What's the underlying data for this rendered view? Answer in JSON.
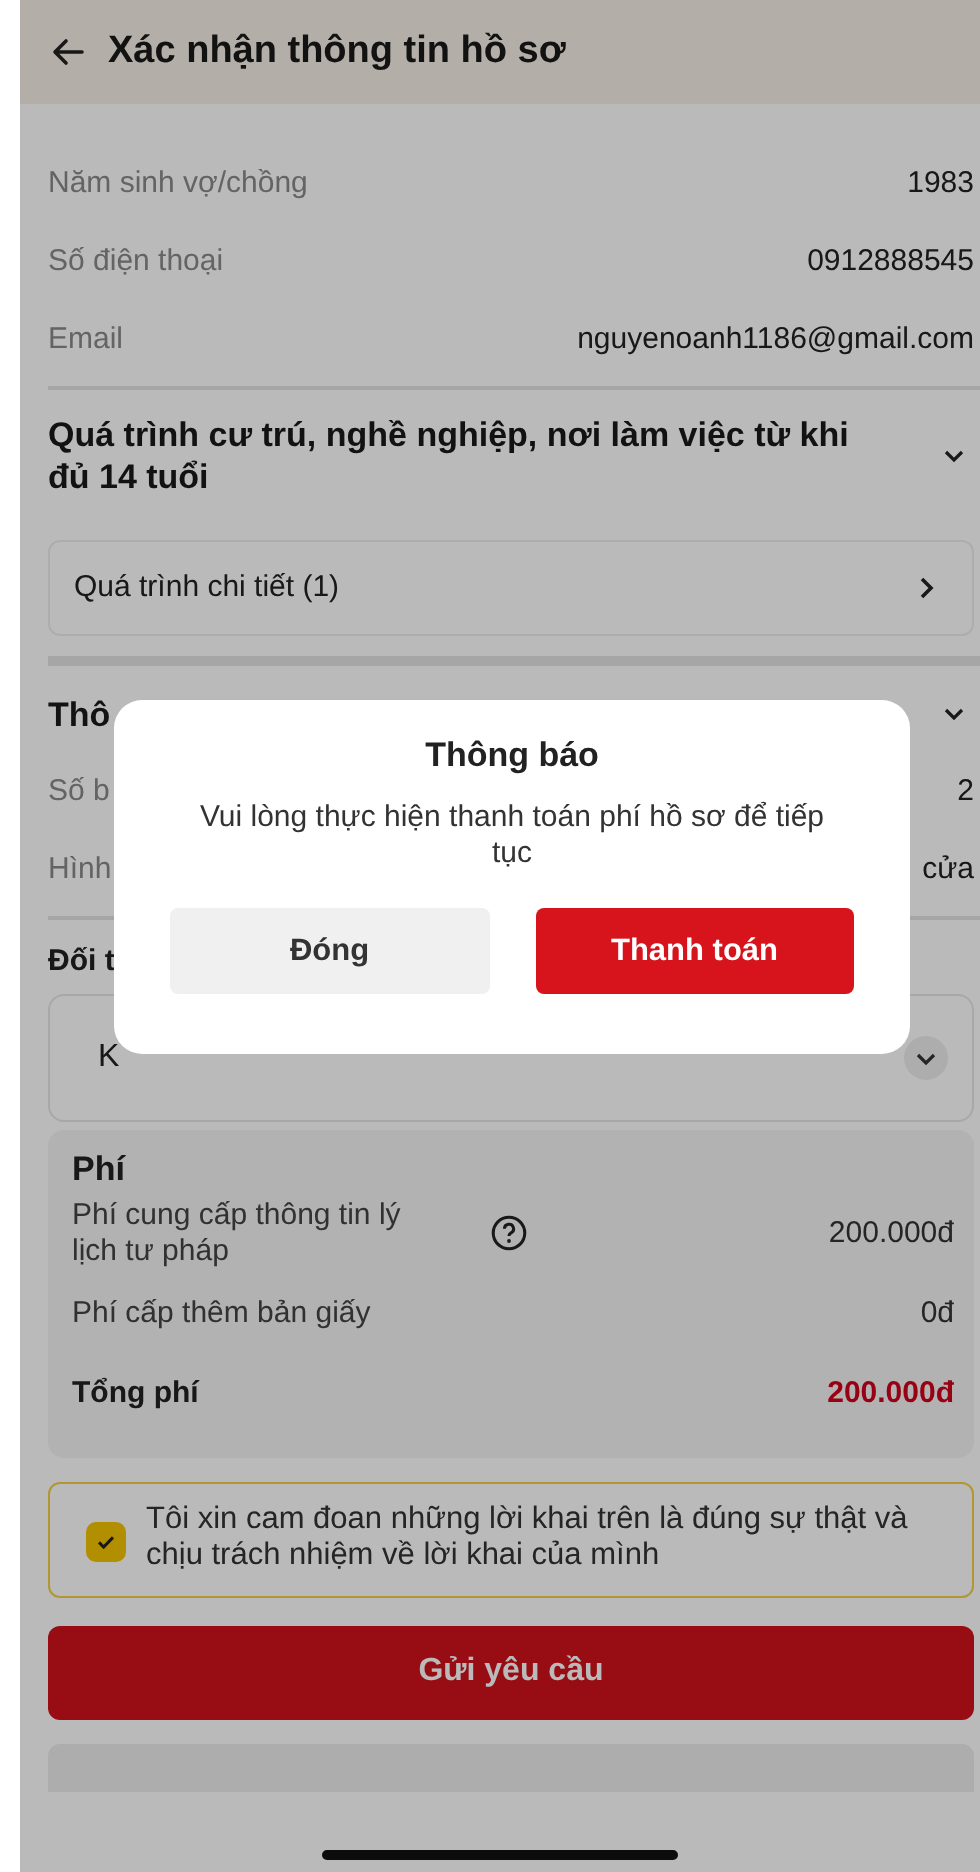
{
  "header": {
    "title": "Xác nhận thông tin hồ sơ"
  },
  "info_rows": [
    {
      "label": "Năm sinh vợ/chồng",
      "value": "1983"
    },
    {
      "label": "Số điện thoại",
      "value": "0912888545"
    },
    {
      "label": "Email",
      "value": "nguyenoanh1186@gmail.com"
    }
  ],
  "residence_section": {
    "title": "Quá trình cư trú, nghề nghiệp, nơi làm việc từ khi đủ 14 tuổi",
    "detail_link": "Quá trình chi tiết (1)"
  },
  "result_section": {
    "title": "Thô",
    "rows": [
      {
        "label": "Số b",
        "value": "2"
      },
      {
        "label": "Hình",
        "value": "cửa"
      }
    ]
  },
  "recipient": {
    "label": "Đối t",
    "select_value": "K"
  },
  "fees": {
    "title": "Phí",
    "items": [
      {
        "label": "Phí cung cấp thông tin lý lịch tư pháp",
        "value": "200.000đ",
        "info": true
      },
      {
        "label": "Phí cấp thêm bản giấy",
        "value": "0đ",
        "info": false
      }
    ],
    "total": {
      "label": "Tổng phí",
      "value": "200.000đ"
    }
  },
  "declaration": {
    "text": "Tôi xin cam đoan những lời khai trên là đúng sự thật và chịu trách nhiệm về lời khai của mình",
    "checked": true
  },
  "submit_button": "Gửi yêu cầu",
  "dialog": {
    "title": "Thông báo",
    "message": "Vui lòng thực hiện thanh toán phí hồ sơ để tiếp tục",
    "buttons": [
      {
        "label": "Đóng",
        "kind": "secondary"
      },
      {
        "label": "Thanh toán",
        "kind": "primary"
      }
    ]
  }
}
